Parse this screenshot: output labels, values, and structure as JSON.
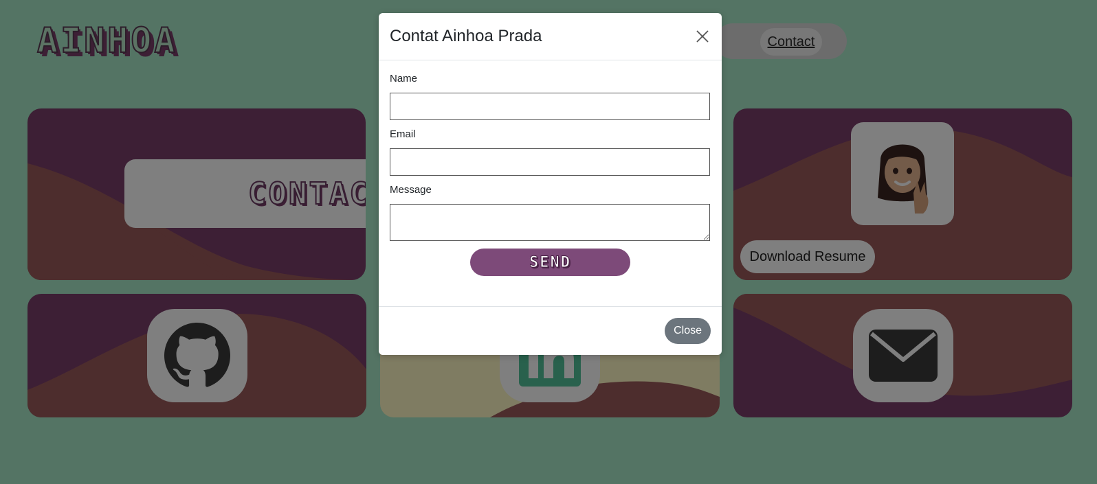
{
  "header": {
    "logo_text": "AINHOA",
    "nav_link": "Contact"
  },
  "cards": {
    "contact_title": "CONTACT",
    "download_resume_label": "Download Resume"
  },
  "icons": {
    "avatar": "avatar-memoji-icon",
    "github": "github-icon",
    "linkedin": "linkedin-icon",
    "mail": "envelope-icon"
  },
  "colors": {
    "page_background": "#a8e8c8",
    "wave_purple": "#7b3f6b",
    "wave_red": "#9b5a5a",
    "wave_cream": "#fff9c4",
    "send_button": "#7d4a79",
    "close_button": "#6c757d",
    "linkedin_green": "#52c39a"
  },
  "modal": {
    "title": "Contat Ainhoa Prada",
    "name_label": "Name",
    "name_value": "",
    "email_label": "Email",
    "email_value": "",
    "message_label": "Message",
    "message_value": "",
    "send_label": "SEND",
    "close_label": "Close"
  }
}
